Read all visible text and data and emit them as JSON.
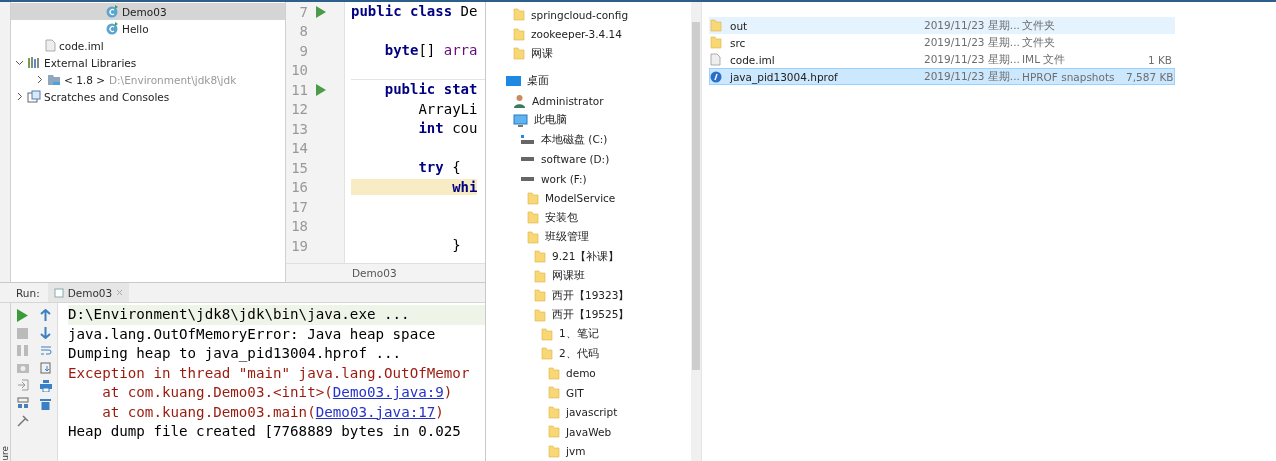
{
  "project_tree": [
    {
      "label": "Demo03",
      "kind": "class",
      "selected": true
    },
    {
      "label": "Hello",
      "kind": "class",
      "selected": false
    },
    {
      "label": "code.iml",
      "kind": "file",
      "selected": false
    },
    {
      "label": "External Libraries",
      "kind": "libraries",
      "selected": false,
      "expanded": true,
      "children": [
        {
          "label": "< 1.8 >",
          "path": "D:\\Environment\\jdk8\\jdk",
          "kind": "sdk",
          "selected": false,
          "expanded": false
        }
      ]
    },
    {
      "label": "Scratches and Consoles",
      "kind": "scratches",
      "selected": false,
      "expanded": false
    }
  ],
  "editor": {
    "tab": "Demo03",
    "lines": [
      {
        "number": "7",
        "run": true,
        "tokens": [
          {
            "text": "public class",
            "kind": "keyword"
          },
          {
            "text": " De",
            "kind": "plain"
          }
        ]
      },
      {
        "number": "8"
      },
      {
        "number": "9",
        "tokens": [
          {
            "text": "    byte",
            "kind": "keyword"
          },
          {
            "text": "[] ",
            "kind": "plain"
          },
          {
            "text": "arra",
            "kind": "field"
          }
        ]
      },
      {
        "number": "10"
      },
      {
        "number": "11",
        "run": true,
        "tokens": [
          {
            "text": "    public stat",
            "kind": "keyword"
          }
        ]
      },
      {
        "number": "12",
        "tokens": [
          {
            "text": "        ArrayLi",
            "kind": "plain"
          }
        ]
      },
      {
        "number": "13",
        "tokens": [
          {
            "text": "        int",
            "kind": "keyword"
          },
          {
            "text": " cou",
            "kind": "plain"
          }
        ]
      },
      {
        "number": "14"
      },
      {
        "number": "15",
        "tokens": [
          {
            "text": "        try",
            "kind": "keyword"
          },
          {
            "text": " {",
            "kind": "plain"
          }
        ]
      },
      {
        "number": "16",
        "tokens": [
          {
            "text": "            whi",
            "kind": "highlighted-keyword"
          }
        ]
      },
      {
        "number": "17"
      },
      {
        "number": "18"
      },
      {
        "number": "19",
        "tokens": [
          {
            "text": "            }",
            "kind": "plain"
          }
        ]
      }
    ]
  },
  "run_panel": {
    "label": "Run:",
    "tab": "Demo03",
    "side_label": "ure",
    "console": [
      {
        "kind": "command",
        "segments": [
          {
            "text": "D:\\Environment\\jdk8\\jdk\\bin\\java.exe ..."
          }
        ]
      },
      {
        "kind": "output",
        "segments": [
          {
            "text": "java.lang.OutOfMemoryError: Java heap space"
          }
        ]
      },
      {
        "kind": "output",
        "segments": [
          {
            "text": "Dumping heap to java_pid13004.hprof ..."
          }
        ]
      },
      {
        "kind": "error",
        "segments": [
          {
            "text": "Exception in thread \"main\" java.lang.OutOfMemor"
          }
        ]
      },
      {
        "kind": "error",
        "segments": [
          {
            "text": "    at com.kuang.Demo03.<init>("
          },
          {
            "text": "Demo03.java:9",
            "kind": "link"
          },
          {
            "text": ")"
          }
        ]
      },
      {
        "kind": "error",
        "segments": [
          {
            "text": "    at com.kuang.Demo03.main("
          },
          {
            "text": "Demo03.java:17",
            "kind": "link"
          },
          {
            "text": ")"
          }
        ]
      },
      {
        "kind": "output",
        "segments": [
          {
            "text": "Heap dump file created [7768889 bytes in 0.025"
          }
        ]
      }
    ]
  },
  "explorer_nav": {
    "quick_access": [
      {
        "label": "springcloud-config",
        "kind": "folder"
      },
      {
        "label": "zookeeper-3.4.14",
        "kind": "folder"
      },
      {
        "label": "网课",
        "kind": "folder"
      }
    ],
    "tree": [
      {
        "label": "桌面",
        "kind": "desktop",
        "children": [
          {
            "label": "Administrator",
            "kind": "user"
          },
          {
            "label": "此电脑",
            "kind": "pc",
            "children": [
              {
                "label": "本地磁盘 (C:)",
                "kind": "system-drive"
              },
              {
                "label": "software (D:)",
                "kind": "drive"
              },
              {
                "label": "work (F:)",
                "kind": "drive",
                "children": [
                  {
                    "label": "ModelService",
                    "kind": "folder"
                  },
                  {
                    "label": "安装包",
                    "kind": "folder"
                  },
                  {
                    "label": "班级管理",
                    "kind": "folder",
                    "children": [
                      {
                        "label": "9.21【补课】",
                        "kind": "folder"
                      },
                      {
                        "label": "网课班",
                        "kind": "folder"
                      },
                      {
                        "label": "西开【19323】",
                        "kind": "folder"
                      },
                      {
                        "label": "西开【19525】",
                        "kind": "folder",
                        "children": [
                          {
                            "label": "1、笔记",
                            "kind": "folder"
                          },
                          {
                            "label": "2、代码",
                            "kind": "folder",
                            "children": [
                              {
                                "label": "demo",
                                "kind": "folder"
                              },
                              {
                                "label": "GIT",
                                "kind": "folder"
                              },
                              {
                                "label": "javascript",
                                "kind": "folder"
                              },
                              {
                                "label": "JavaWeb",
                                "kind": "folder"
                              },
                              {
                                "label": "jvm",
                                "kind": "folder"
                              }
                            ]
                          }
                        ]
                      }
                    ]
                  }
                ]
              }
            ]
          }
        ]
      }
    ]
  },
  "files": [
    {
      "name": "out",
      "kind": "folder",
      "date": "2019/11/23 星期...",
      "type": "文件夹",
      "selected": false,
      "hovered": true
    },
    {
      "name": "src",
      "kind": "folder",
      "date": "2019/11/23 星期...",
      "type": "文件夹",
      "selected": false,
      "hovered": false
    },
    {
      "name": "code.iml",
      "kind": "file",
      "date": "2019/11/23 星期...",
      "type": "IML 文件",
      "size": "1 KB",
      "selected": false,
      "hovered": false
    },
    {
      "name": "java_pid13004.hprof",
      "kind": "hprof",
      "date": "2019/11/23 星期...",
      "type": "HPROF snapshots",
      "size": "7,587 KB",
      "selected": true,
      "hovered": false
    }
  ]
}
